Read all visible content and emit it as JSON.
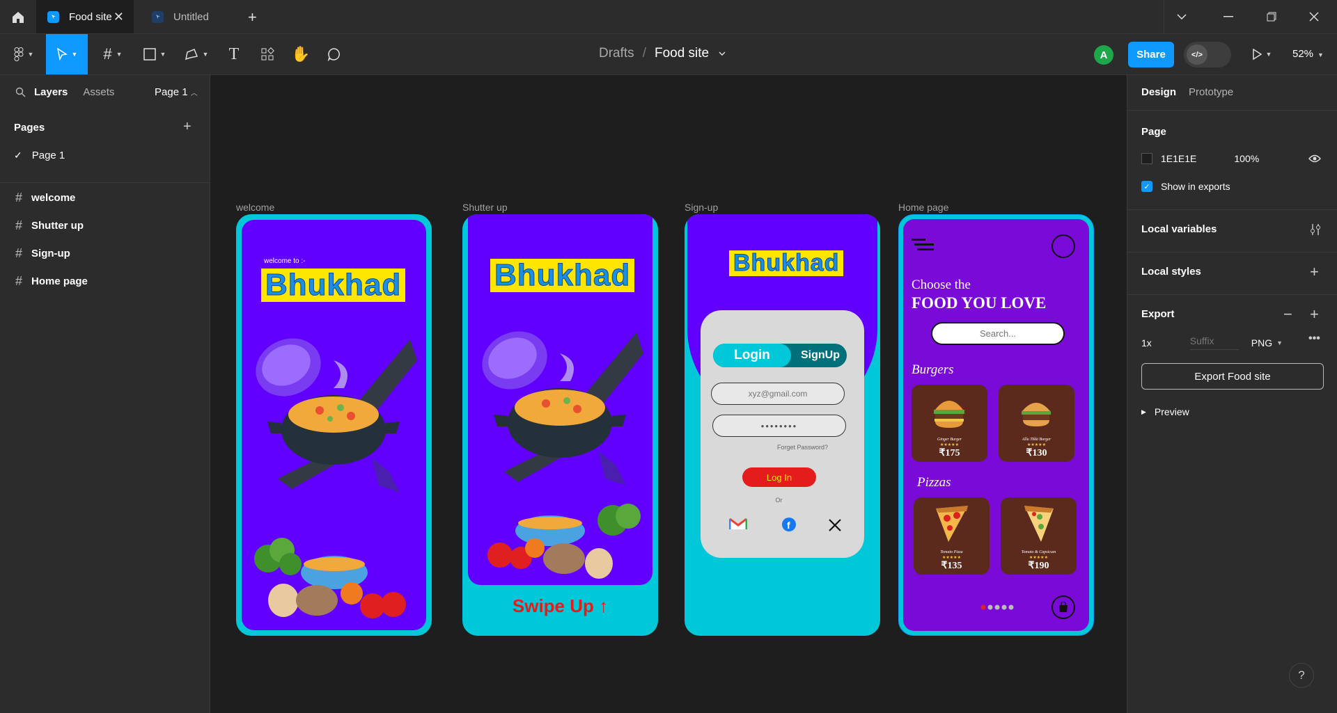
{
  "tabs": [
    {
      "label": "Food site",
      "active": true
    },
    {
      "label": "Untitled",
      "active": false
    }
  ],
  "breadcrumb": {
    "drafts": "Drafts",
    "slash": "/",
    "file": "Food site"
  },
  "avatar_letter": "A",
  "share_label": "Share",
  "devmode_label": "</>",
  "zoom": "52%",
  "left_panel": {
    "tab_layers": "Layers",
    "tab_assets": "Assets",
    "page_select": "Page 1",
    "pages_title": "Pages",
    "pages": [
      "Page 1"
    ],
    "layers": [
      "welcome",
      "Shutter up",
      "Sign-up",
      "Home page"
    ]
  },
  "right_panel": {
    "tab_design": "Design",
    "tab_prototype": "Prototype",
    "page_title": "Page",
    "bg_hex": "1E1E1E",
    "bg_opacity": "100%",
    "show_in_exports": "Show in exports",
    "local_variables": "Local variables",
    "local_styles": "Local styles",
    "export_title": "Export",
    "export_scale": "1x",
    "export_suffix": "Suffix",
    "export_format": "PNG",
    "export_button": "Export Food site",
    "preview": "Preview"
  },
  "frames": {
    "welcome": {
      "label": "welcome",
      "subtitle": "welcome to :-",
      "brand": "Bhukhad"
    },
    "shutter": {
      "label": "Shutter up",
      "brand": "Bhukhad",
      "swipe": "Swipe Up"
    },
    "signup": {
      "label": "Sign-up",
      "brand": "Bhukhad",
      "login_tab": "Login",
      "signup_tab": "SignUp",
      "email_placeholder": "xyz@gmail.com",
      "password_mask": "••••••••",
      "forgot": "Forget Password?",
      "login_button": "Log In",
      "or": "Or"
    },
    "home": {
      "label": "Home page",
      "heading1": "Choose the",
      "heading2": "FOOD YOU LOVE",
      "search_placeholder": "Search...",
      "burgers_title": "Burgers",
      "pizzas_title": "Pizzas",
      "burgers": [
        {
          "name": "Ginger Burger",
          "stars": "★★★★★",
          "price": "₹175"
        },
        {
          "name": "Allu Tikki Burger",
          "stars": "★★★★★",
          "price": "₹130"
        }
      ],
      "pizzas": [
        {
          "name": "Tomato Pizza",
          "stars": "★★★★★",
          "price": "₹135"
        },
        {
          "name": "Tomato & Capsicum",
          "stars": "★★★★★",
          "price": "₹190"
        }
      ]
    }
  },
  "colors": {
    "accent": "#0d99ff",
    "frame_purple": "#6200ff",
    "frame_cyan": "#00c8d8",
    "home_purple": "#7a0ad8"
  }
}
